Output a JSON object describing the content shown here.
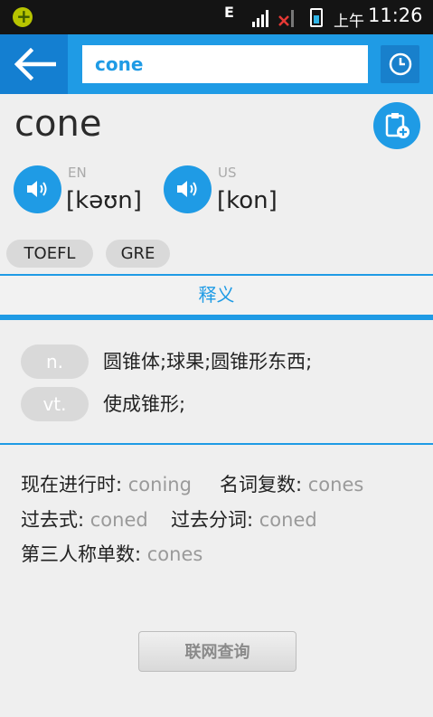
{
  "status_bar": {
    "network_letter": "E",
    "sim1": "1",
    "sim2": "2",
    "ampm": "上午",
    "time": "11:26"
  },
  "header": {
    "back_icon": "arrow-left-icon",
    "search_value": "cone",
    "history_icon": "clock-icon"
  },
  "word": {
    "text": "cone",
    "wordbook_icon": "clipboard-add-icon"
  },
  "pronunciations": [
    {
      "label": "EN",
      "phonetic": "[kəʊn]",
      "icon": "speaker-icon"
    },
    {
      "label": "US",
      "phonetic": "[kon]",
      "icon": "speaker-icon"
    }
  ],
  "tags": [
    "TOEFL",
    "GRE"
  ],
  "section_title": "释义",
  "definitions": [
    {
      "pos": "n.",
      "text": "圆锥体;球果;圆锥形东西;"
    },
    {
      "pos": "vt.",
      "text": "使成锥形;"
    }
  ],
  "inflections": [
    {
      "label": "现在进行时:",
      "value": "coning"
    },
    {
      "label": "名词复数:",
      "value": "cones"
    },
    {
      "label": "过去式:",
      "value": "coned"
    },
    {
      "label": "过去分词:",
      "value": "coned"
    },
    {
      "label": "第三人称单数:",
      "value": "cones"
    }
  ],
  "online_button": "联网查询",
  "colors": {
    "accent": "#1f9be5",
    "accent_dark": "#147fd1",
    "tag_bg": "#d9d9d9",
    "muted_text": "#9a9a9a"
  }
}
